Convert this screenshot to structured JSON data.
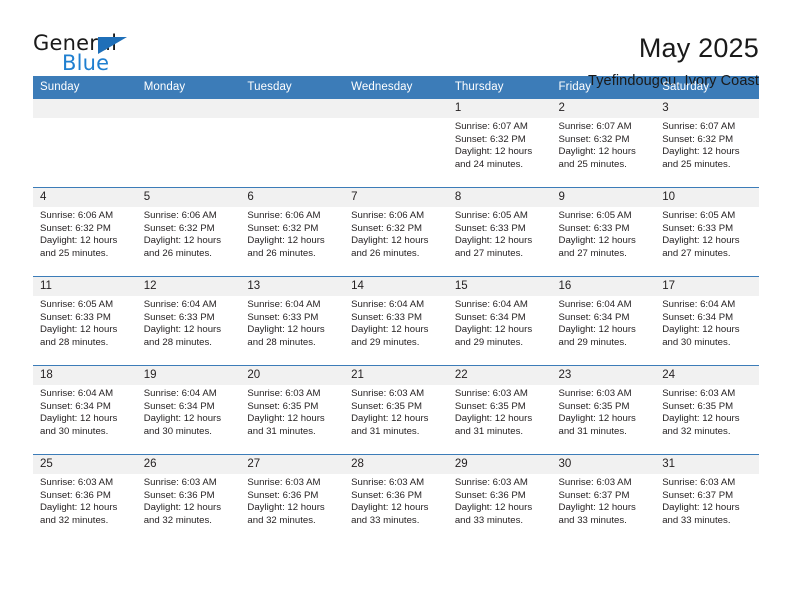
{
  "logo": {
    "primary": "General",
    "secondary": "Blue",
    "triangle_color": "#1f6fb8"
  },
  "header": {
    "title": "May 2025",
    "subtitle": "Tyefindougou, Ivory Coast"
  },
  "theme": {
    "header_blue": "#3c7cb8",
    "daynum_gray": "#f1f1f1",
    "text": "#231f20"
  },
  "calendar": {
    "weekday_headers": [
      "Sunday",
      "Monday",
      "Tuesday",
      "Wednesday",
      "Thursday",
      "Friday",
      "Saturday"
    ],
    "weeks": [
      [
        {
          "day": "",
          "sunrise": "",
          "sunset": "",
          "daylight": "",
          "daylight2": ""
        },
        {
          "day": "",
          "sunrise": "",
          "sunset": "",
          "daylight": "",
          "daylight2": ""
        },
        {
          "day": "",
          "sunrise": "",
          "sunset": "",
          "daylight": "",
          "daylight2": ""
        },
        {
          "day": "",
          "sunrise": "",
          "sunset": "",
          "daylight": "",
          "daylight2": ""
        },
        {
          "day": "1",
          "sunrise": "Sunrise: 6:07 AM",
          "sunset": "Sunset: 6:32 PM",
          "daylight": "Daylight: 12 hours",
          "daylight2": "and 24 minutes."
        },
        {
          "day": "2",
          "sunrise": "Sunrise: 6:07 AM",
          "sunset": "Sunset: 6:32 PM",
          "daylight": "Daylight: 12 hours",
          "daylight2": "and 25 minutes."
        },
        {
          "day": "3",
          "sunrise": "Sunrise: 6:07 AM",
          "sunset": "Sunset: 6:32 PM",
          "daylight": "Daylight: 12 hours",
          "daylight2": "and 25 minutes."
        }
      ],
      [
        {
          "day": "4",
          "sunrise": "Sunrise: 6:06 AM",
          "sunset": "Sunset: 6:32 PM",
          "daylight": "Daylight: 12 hours",
          "daylight2": "and 25 minutes."
        },
        {
          "day": "5",
          "sunrise": "Sunrise: 6:06 AM",
          "sunset": "Sunset: 6:32 PM",
          "daylight": "Daylight: 12 hours",
          "daylight2": "and 26 minutes."
        },
        {
          "day": "6",
          "sunrise": "Sunrise: 6:06 AM",
          "sunset": "Sunset: 6:32 PM",
          "daylight": "Daylight: 12 hours",
          "daylight2": "and 26 minutes."
        },
        {
          "day": "7",
          "sunrise": "Sunrise: 6:06 AM",
          "sunset": "Sunset: 6:32 PM",
          "daylight": "Daylight: 12 hours",
          "daylight2": "and 26 minutes."
        },
        {
          "day": "8",
          "sunrise": "Sunrise: 6:05 AM",
          "sunset": "Sunset: 6:33 PM",
          "daylight": "Daylight: 12 hours",
          "daylight2": "and 27 minutes."
        },
        {
          "day": "9",
          "sunrise": "Sunrise: 6:05 AM",
          "sunset": "Sunset: 6:33 PM",
          "daylight": "Daylight: 12 hours",
          "daylight2": "and 27 minutes."
        },
        {
          "day": "10",
          "sunrise": "Sunrise: 6:05 AM",
          "sunset": "Sunset: 6:33 PM",
          "daylight": "Daylight: 12 hours",
          "daylight2": "and 27 minutes."
        }
      ],
      [
        {
          "day": "11",
          "sunrise": "Sunrise: 6:05 AM",
          "sunset": "Sunset: 6:33 PM",
          "daylight": "Daylight: 12 hours",
          "daylight2": "and 28 minutes."
        },
        {
          "day": "12",
          "sunrise": "Sunrise: 6:04 AM",
          "sunset": "Sunset: 6:33 PM",
          "daylight": "Daylight: 12 hours",
          "daylight2": "and 28 minutes."
        },
        {
          "day": "13",
          "sunrise": "Sunrise: 6:04 AM",
          "sunset": "Sunset: 6:33 PM",
          "daylight": "Daylight: 12 hours",
          "daylight2": "and 28 minutes."
        },
        {
          "day": "14",
          "sunrise": "Sunrise: 6:04 AM",
          "sunset": "Sunset: 6:33 PM",
          "daylight": "Daylight: 12 hours",
          "daylight2": "and 29 minutes."
        },
        {
          "day": "15",
          "sunrise": "Sunrise: 6:04 AM",
          "sunset": "Sunset: 6:34 PM",
          "daylight": "Daylight: 12 hours",
          "daylight2": "and 29 minutes."
        },
        {
          "day": "16",
          "sunrise": "Sunrise: 6:04 AM",
          "sunset": "Sunset: 6:34 PM",
          "daylight": "Daylight: 12 hours",
          "daylight2": "and 29 minutes."
        },
        {
          "day": "17",
          "sunrise": "Sunrise: 6:04 AM",
          "sunset": "Sunset: 6:34 PM",
          "daylight": "Daylight: 12 hours",
          "daylight2": "and 30 minutes."
        }
      ],
      [
        {
          "day": "18",
          "sunrise": "Sunrise: 6:04 AM",
          "sunset": "Sunset: 6:34 PM",
          "daylight": "Daylight: 12 hours",
          "daylight2": "and 30 minutes."
        },
        {
          "day": "19",
          "sunrise": "Sunrise: 6:04 AM",
          "sunset": "Sunset: 6:34 PM",
          "daylight": "Daylight: 12 hours",
          "daylight2": "and 30 minutes."
        },
        {
          "day": "20",
          "sunrise": "Sunrise: 6:03 AM",
          "sunset": "Sunset: 6:35 PM",
          "daylight": "Daylight: 12 hours",
          "daylight2": "and 31 minutes."
        },
        {
          "day": "21",
          "sunrise": "Sunrise: 6:03 AM",
          "sunset": "Sunset: 6:35 PM",
          "daylight": "Daylight: 12 hours",
          "daylight2": "and 31 minutes."
        },
        {
          "day": "22",
          "sunrise": "Sunrise: 6:03 AM",
          "sunset": "Sunset: 6:35 PM",
          "daylight": "Daylight: 12 hours",
          "daylight2": "and 31 minutes."
        },
        {
          "day": "23",
          "sunrise": "Sunrise: 6:03 AM",
          "sunset": "Sunset: 6:35 PM",
          "daylight": "Daylight: 12 hours",
          "daylight2": "and 31 minutes."
        },
        {
          "day": "24",
          "sunrise": "Sunrise: 6:03 AM",
          "sunset": "Sunset: 6:35 PM",
          "daylight": "Daylight: 12 hours",
          "daylight2": "and 32 minutes."
        }
      ],
      [
        {
          "day": "25",
          "sunrise": "Sunrise: 6:03 AM",
          "sunset": "Sunset: 6:36 PM",
          "daylight": "Daylight: 12 hours",
          "daylight2": "and 32 minutes."
        },
        {
          "day": "26",
          "sunrise": "Sunrise: 6:03 AM",
          "sunset": "Sunset: 6:36 PM",
          "daylight": "Daylight: 12 hours",
          "daylight2": "and 32 minutes."
        },
        {
          "day": "27",
          "sunrise": "Sunrise: 6:03 AM",
          "sunset": "Sunset: 6:36 PM",
          "daylight": "Daylight: 12 hours",
          "daylight2": "and 32 minutes."
        },
        {
          "day": "28",
          "sunrise": "Sunrise: 6:03 AM",
          "sunset": "Sunset: 6:36 PM",
          "daylight": "Daylight: 12 hours",
          "daylight2": "and 33 minutes."
        },
        {
          "day": "29",
          "sunrise": "Sunrise: 6:03 AM",
          "sunset": "Sunset: 6:36 PM",
          "daylight": "Daylight: 12 hours",
          "daylight2": "and 33 minutes."
        },
        {
          "day": "30",
          "sunrise": "Sunrise: 6:03 AM",
          "sunset": "Sunset: 6:37 PM",
          "daylight": "Daylight: 12 hours",
          "daylight2": "and 33 minutes."
        },
        {
          "day": "31",
          "sunrise": "Sunrise: 6:03 AM",
          "sunset": "Sunset: 6:37 PM",
          "daylight": "Daylight: 12 hours",
          "daylight2": "and 33 minutes."
        }
      ]
    ]
  }
}
